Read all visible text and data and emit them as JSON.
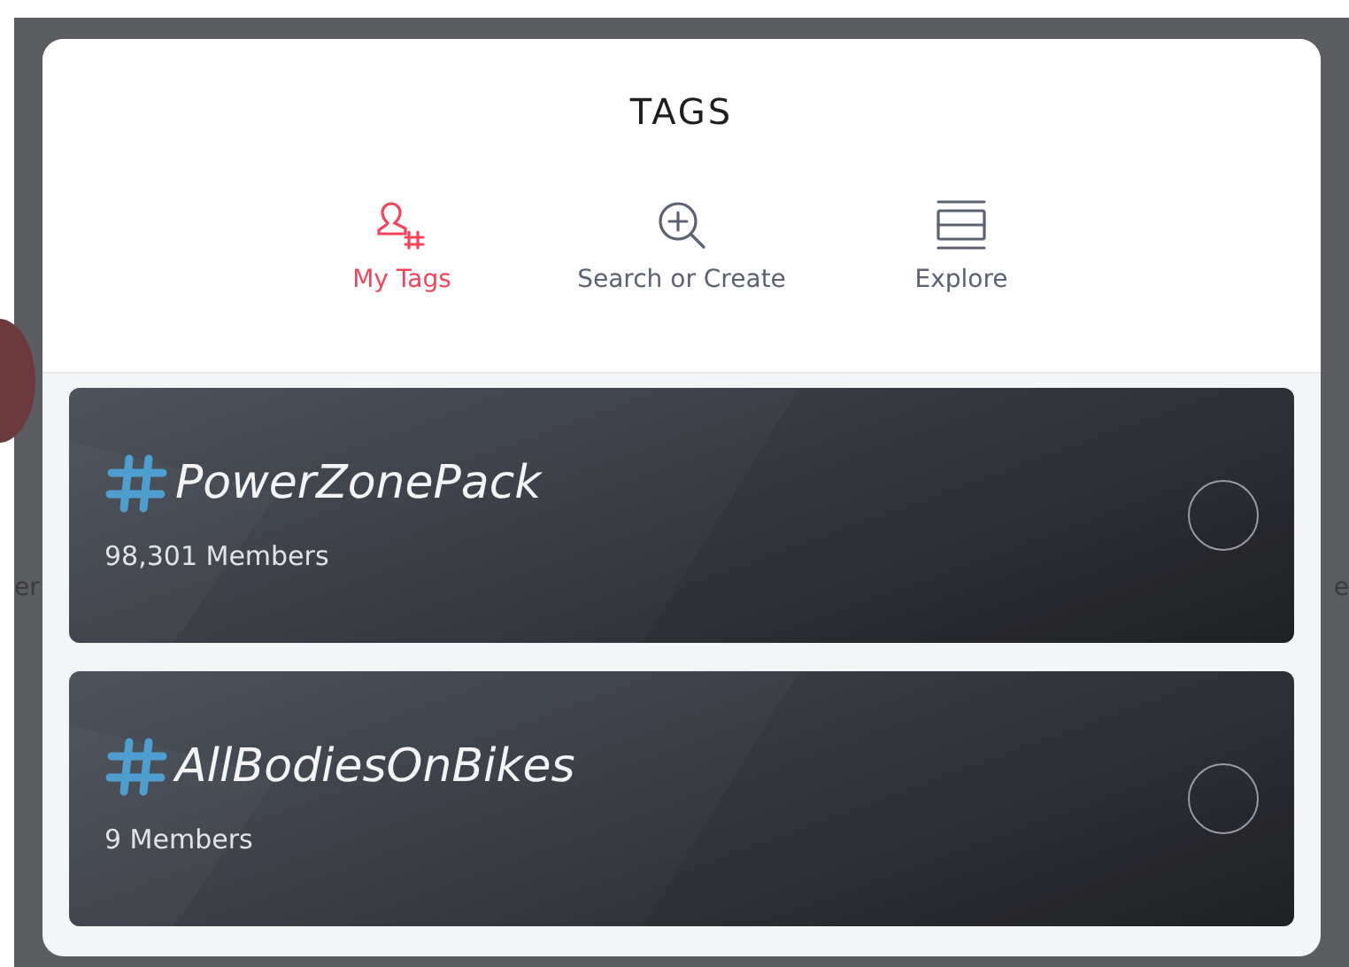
{
  "background_texts": [
    "er",
    "e"
  ],
  "modal": {
    "title": "TAGS",
    "tabs": [
      {
        "label": "My Tags",
        "kind": "mine",
        "selected": true
      },
      {
        "label": "Search or Create",
        "kind": "search",
        "selected": false
      },
      {
        "label": "Explore",
        "kind": "explore",
        "selected": false
      }
    ],
    "tags": [
      {
        "name": "PowerZonePack",
        "members": "98,301 Members",
        "selected": false
      },
      {
        "name": "AllBodiesOnBikes",
        "members": "9 Members",
        "selected": false
      }
    ]
  }
}
